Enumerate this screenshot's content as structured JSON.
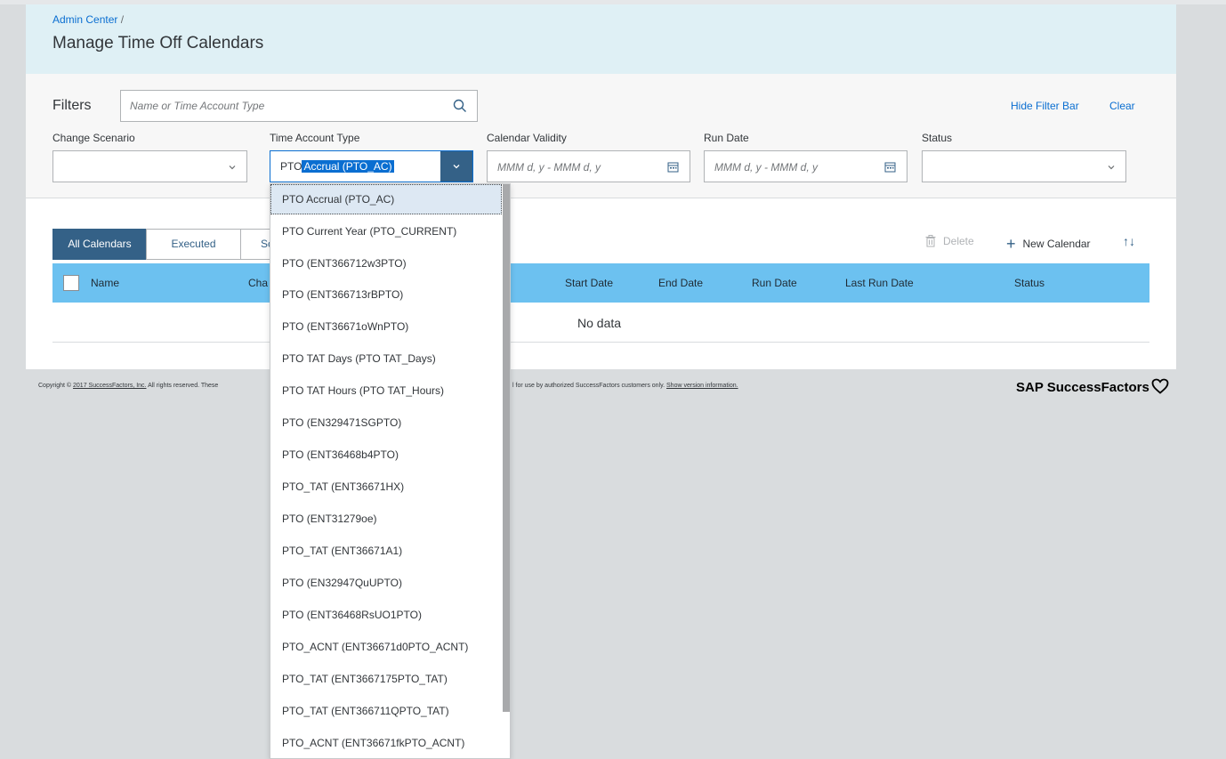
{
  "breadcrumb": {
    "link": "Admin Center",
    "separator": "/"
  },
  "page": {
    "title": "Manage Time Off Calendars"
  },
  "filterbar": {
    "label": "Filters",
    "search_placeholder": "Name or Time Account Type",
    "hide_filter_bar": "Hide Filter Bar",
    "clear": "Clear"
  },
  "filters": {
    "change_scenario": {
      "label": "Change Scenario",
      "value": ""
    },
    "time_account_type": {
      "label": "Time Account Type",
      "value_prefix": "PTO",
      "value_selected": "Accrual (PTO_AC)"
    },
    "calendar_validity": {
      "label": "Calendar Validity",
      "placeholder": "MMM d, y - MMM d, y"
    },
    "run_date": {
      "label": "Run Date",
      "placeholder": "MMM d, y - MMM d, y"
    },
    "status": {
      "label": "Status",
      "value": ""
    }
  },
  "tabs": [
    {
      "label": "All Calendars",
      "active": true
    },
    {
      "label": "Executed",
      "active": false
    },
    {
      "label": "Sc",
      "active": false
    }
  ],
  "toolbar": {
    "delete": "Delete",
    "new_calendar": "New Calendar"
  },
  "table": {
    "columns": [
      "Name",
      "Cha",
      "Start Date",
      "End Date",
      "Run Date",
      "Last Run Date",
      "Status"
    ],
    "empty_text": "No data"
  },
  "dropdown": {
    "items": [
      "PTO Accrual (PTO_AC)",
      "PTO Current Year (PTO_CURRENT)",
      "PTO (ENT366712w3PTO)",
      "PTO (ENT366713rBPTO)",
      "PTO (ENT36671oWnPTO)",
      "PTO TAT Days (PTO TAT_Days)",
      "PTO TAT Hours (PTO TAT_Hours)",
      "PTO (EN329471SGPTO)",
      "PTO (ENT36468b4PTO)",
      "PTO_TAT (ENT36671HX)",
      "PTO (ENT31279oe)",
      "PTO_TAT (ENT36671A1)",
      "PTO (EN32947QuUPTO)",
      "PTO (ENT36468RsUO1PTO)",
      "PTO_ACNT (ENT36671d0PTO_ACNT)",
      "PTO_TAT (ENT3667175PTO_TAT)",
      "PTO_TAT (ENT366711QPTO_TAT)",
      "PTO_ACNT (ENT36671fkPTO_ACNT)"
    ]
  },
  "footer": {
    "copyright_prefix": "Copyright ©",
    "copyright_link": "2017 SuccessFactors, Inc.",
    "copyright_rest": "All rights reserved. These",
    "copyright_tail": "l for use by authorized SuccessFactors customers only.",
    "version_link": "Show version information.",
    "brand": "SAP SuccessFactors"
  },
  "colors": {
    "accent": "#346187",
    "link": "#0a6ed1",
    "table_header": "#6cc1f0",
    "header_bg": "#dff0f5"
  }
}
